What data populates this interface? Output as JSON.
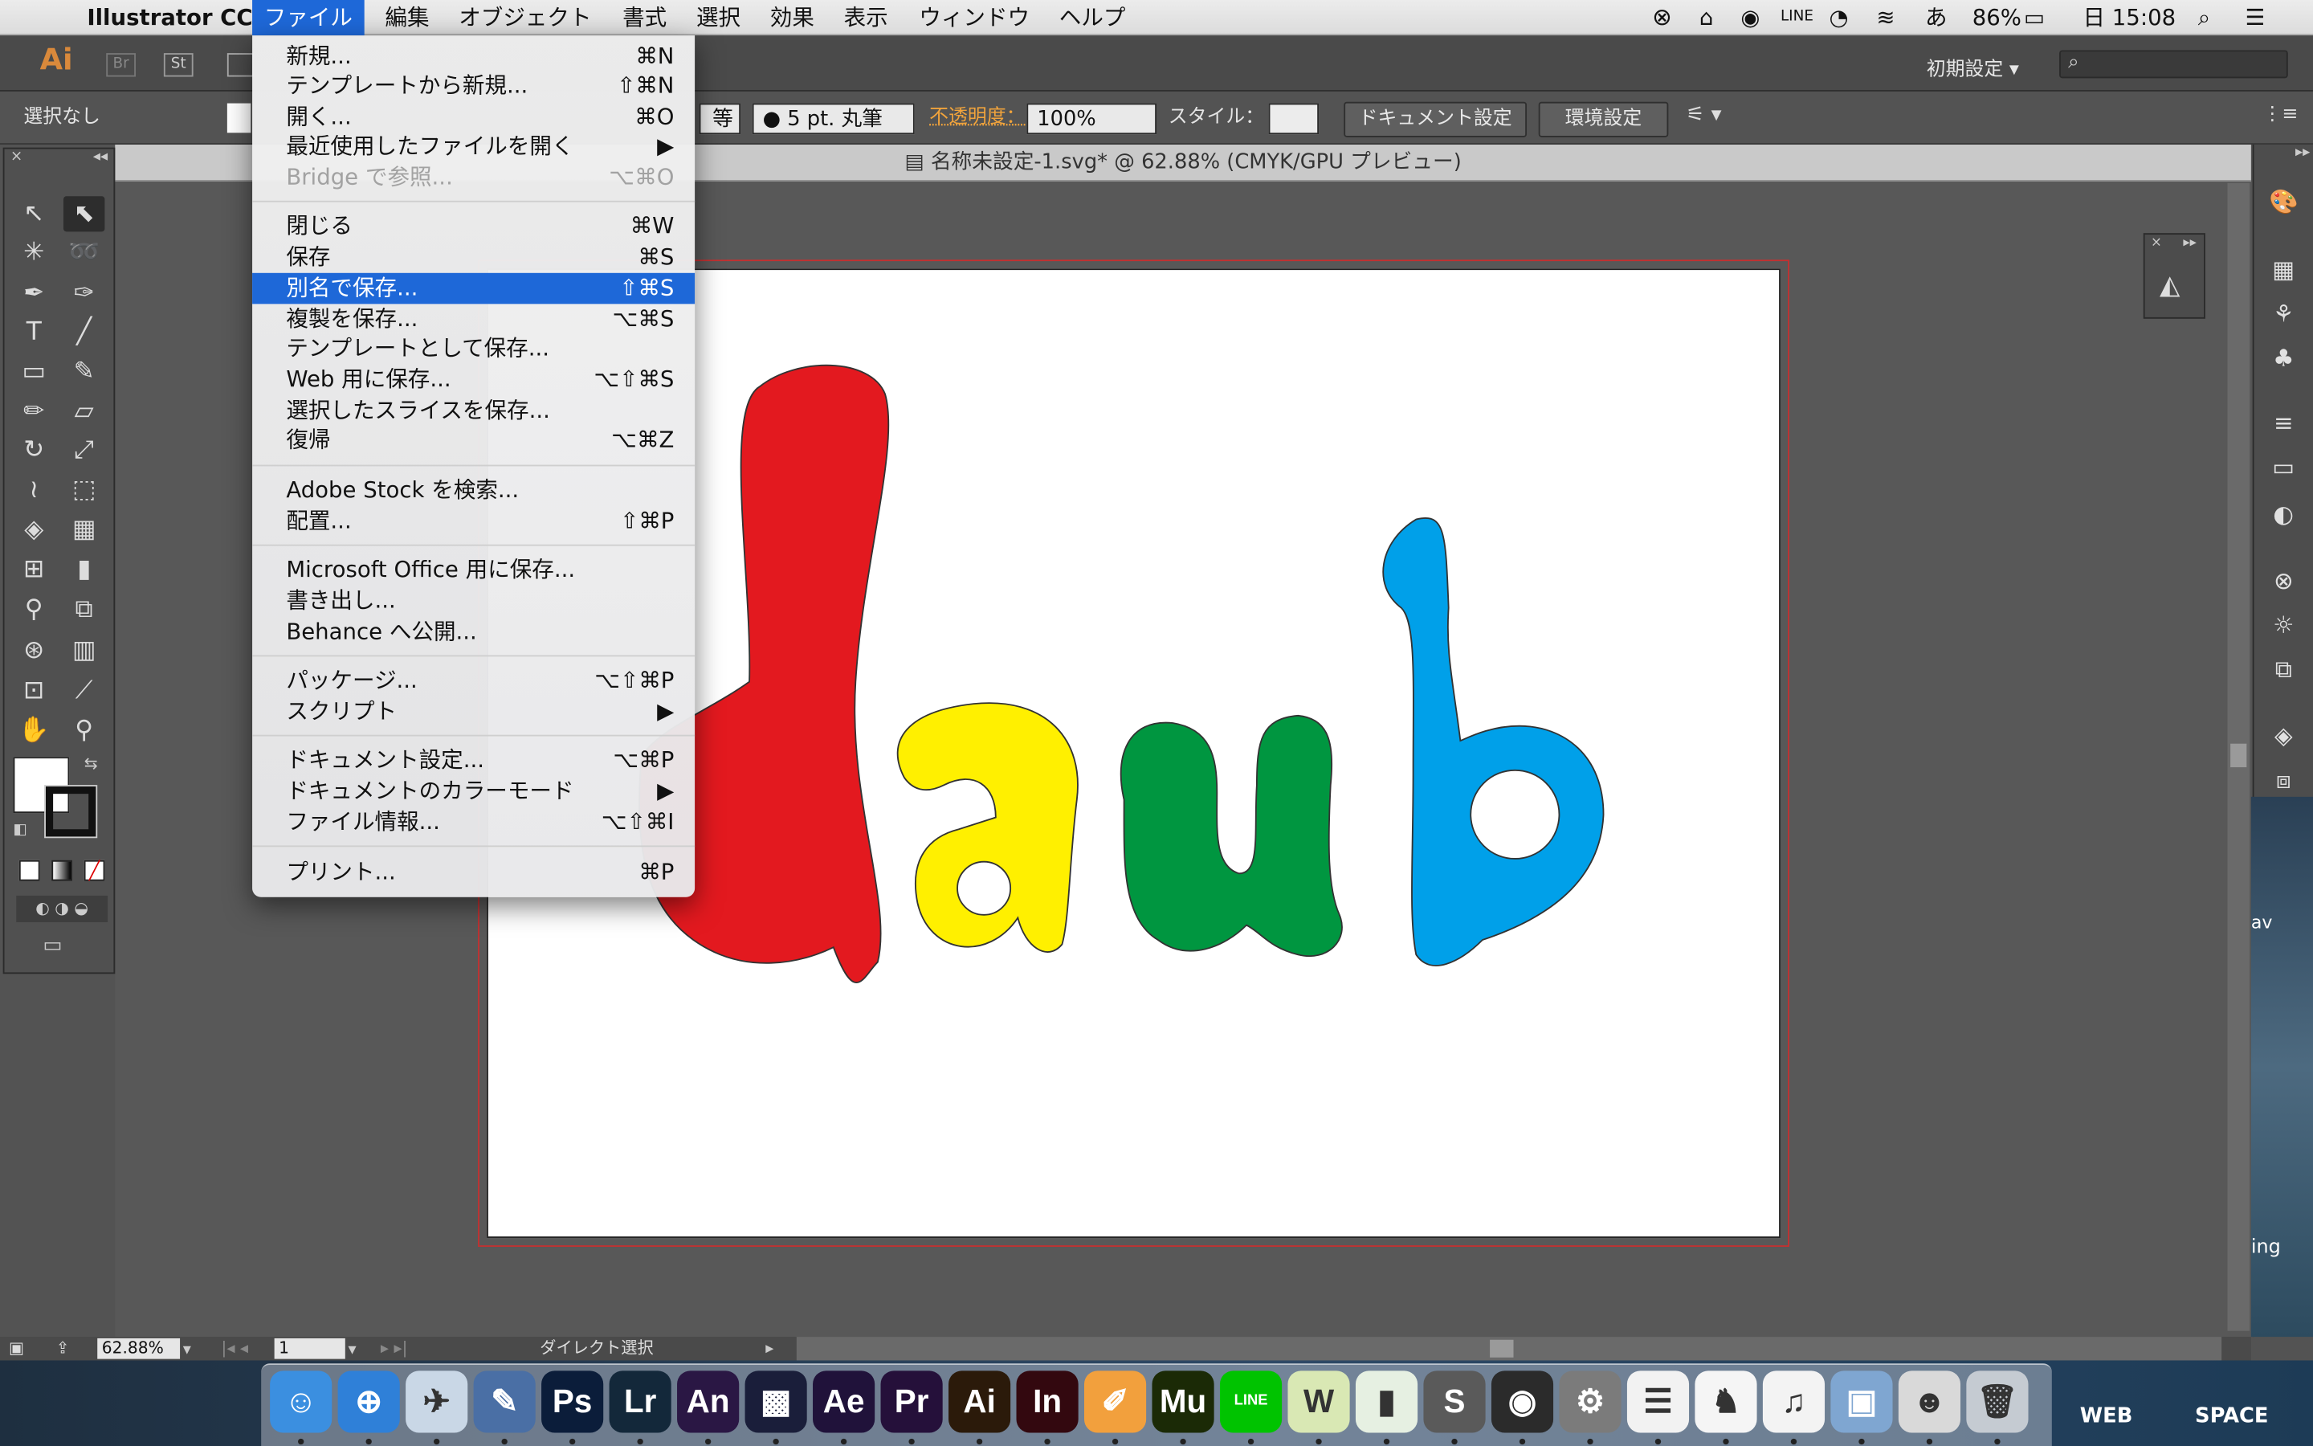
{
  "menubar": {
    "app_name": "Illustrator CC",
    "menus": [
      "ファイル",
      "編集",
      "オブジェクト",
      "書式",
      "選択",
      "効果",
      "表示",
      "ウィンドウ",
      "ヘルプ"
    ],
    "battery": "86%",
    "clock": "日 15:08"
  },
  "controlbar": {
    "ai_logo": "Ai",
    "br": "Br",
    "st": "St",
    "workspace": "初期設定",
    "workspace_arrow": "▾"
  },
  "propbar": {
    "selection": "選択なし",
    "stroke_profile_tail": "等",
    "brush": "5 pt. 丸筆",
    "opacity_label": "不透明度：",
    "opacity_value": "100%",
    "style_label": "スタイル：",
    "doc_setup_button": "ドキュメント設定",
    "prefs_button": "環境設定"
  },
  "document": {
    "tab_title": "名称未設定-1.svg* @ 62.88% (CMYK/GPU プレビュー)",
    "artwork_letters": [
      "d",
      "a",
      "u",
      "b"
    ],
    "colors": {
      "d": "#e3191f",
      "a": "#fff000",
      "u": "#009640",
      "b": "#00a0e9"
    }
  },
  "file_menu": {
    "items": [
      {
        "label": "新規...",
        "shortcut": "⌘N"
      },
      {
        "label": "テンプレートから新規...",
        "shortcut": "⇧⌘N"
      },
      {
        "label": "開く...",
        "shortcut": "⌘O"
      },
      {
        "label": "最近使用したファイルを開く",
        "shortcut": "▶"
      },
      {
        "label": "Bridge で参照...",
        "shortcut": "⌥⌘O"
      },
      {
        "label": "閉じる",
        "shortcut": "⌘W"
      },
      {
        "label": "保存",
        "shortcut": "⌘S"
      },
      {
        "label": "別名で保存...",
        "shortcut": "⇧⌘S"
      },
      {
        "label": "複製を保存...",
        "shortcut": "⌥⌘S"
      },
      {
        "label": "テンプレートとして保存...",
        "shortcut": ""
      },
      {
        "label": "Web 用に保存...",
        "shortcut": "⌥⇧⌘S"
      },
      {
        "label": "選択したスライスを保存...",
        "shortcut": ""
      },
      {
        "label": "復帰",
        "shortcut": "⌥⌘Z"
      },
      {
        "label": "Adobe Stock を検索...",
        "shortcut": ""
      },
      {
        "label": "配置...",
        "shortcut": "⇧⌘P"
      },
      {
        "label": "Microsoft Office 用に保存...",
        "shortcut": ""
      },
      {
        "label": "書き出し...",
        "shortcut": ""
      },
      {
        "label": "Behance へ公開...",
        "shortcut": ""
      },
      {
        "label": "パッケージ...",
        "shortcut": "⌥⇧⌘P"
      },
      {
        "label": "スクリプト",
        "shortcut": "▶"
      },
      {
        "label": "ドキュメント設定...",
        "shortcut": "⌥⌘P"
      },
      {
        "label": "ドキュメントのカラーモード",
        "shortcut": "▶"
      },
      {
        "label": "ファイル情報...",
        "shortcut": "⌥⇧⌘I"
      },
      {
        "label": "プリント...",
        "shortcut": "⌘P"
      }
    ]
  },
  "statusbar": {
    "zoom": "62.88%",
    "artboard": "1",
    "tool_name": "ダイレクト選択"
  },
  "dock": {
    "apps": [
      {
        "name": "finder",
        "label": "☺",
        "bg": "#3b8fe0"
      },
      {
        "name": "safari",
        "label": "⊕",
        "bg": "#2f80d8"
      },
      {
        "name": "preview",
        "label": "✈",
        "bg": "#c9d7e6"
      },
      {
        "name": "xcode-dev",
        "label": "✎",
        "bg": "#4a6fa5"
      },
      {
        "name": "photoshop",
        "label": "Ps",
        "bg": "#0b1d3a"
      },
      {
        "name": "lightroom",
        "label": "Lr",
        "bg": "#13283a"
      },
      {
        "name": "animate",
        "label": "An",
        "bg": "#2a1744"
      },
      {
        "name": "media-encoder",
        "label": "▩",
        "bg": "#1a1e3a"
      },
      {
        "name": "after-effects",
        "label": "Ae",
        "bg": "#20123a"
      },
      {
        "name": "premiere",
        "label": "Pr",
        "bg": "#25103a"
      },
      {
        "name": "illustrator",
        "label": "Ai",
        "bg": "#2b1a0a"
      },
      {
        "name": "indesign",
        "label": "In",
        "bg": "#33080f"
      },
      {
        "name": "pages",
        "label": "✐",
        "bg": "#f2a03d"
      },
      {
        "name": "muse",
        "label": "Mu",
        "bg": "#1b2a06"
      },
      {
        "name": "line",
        "label": "LINE",
        "bg": "#00c300"
      },
      {
        "name": "word-app",
        "label": "W",
        "bg": "#d9e8b4"
      },
      {
        "name": "numbers",
        "label": "▮",
        "bg": "#e6f0e2"
      },
      {
        "name": "sublime",
        "label": "S",
        "bg": "#5a5a5a"
      },
      {
        "name": "app-one",
        "label": "◉",
        "bg": "#2b2b2b"
      },
      {
        "name": "system-prefs",
        "label": "⚙",
        "bg": "#7b7b7b"
      },
      {
        "name": "reminders",
        "label": "☰",
        "bg": "#f2f2f2"
      },
      {
        "name": "character-app",
        "label": "♞",
        "bg": "#f5f5f5"
      },
      {
        "name": "itunes",
        "label": "♫",
        "bg": "#f3f3f3"
      },
      {
        "name": "iphoto",
        "label": "▣",
        "bg": "#7fa6d1"
      },
      {
        "name": "photo-folder",
        "label": "☻",
        "bg": "#d9d9d9"
      },
      {
        "name": "trash",
        "label": "🗑",
        "bg": "#c5cbd2"
      }
    ]
  },
  "desktop": {
    "label_web": "WEB",
    "label_space": "SPACE",
    "label_ing": "ing",
    "label_av": "av"
  }
}
